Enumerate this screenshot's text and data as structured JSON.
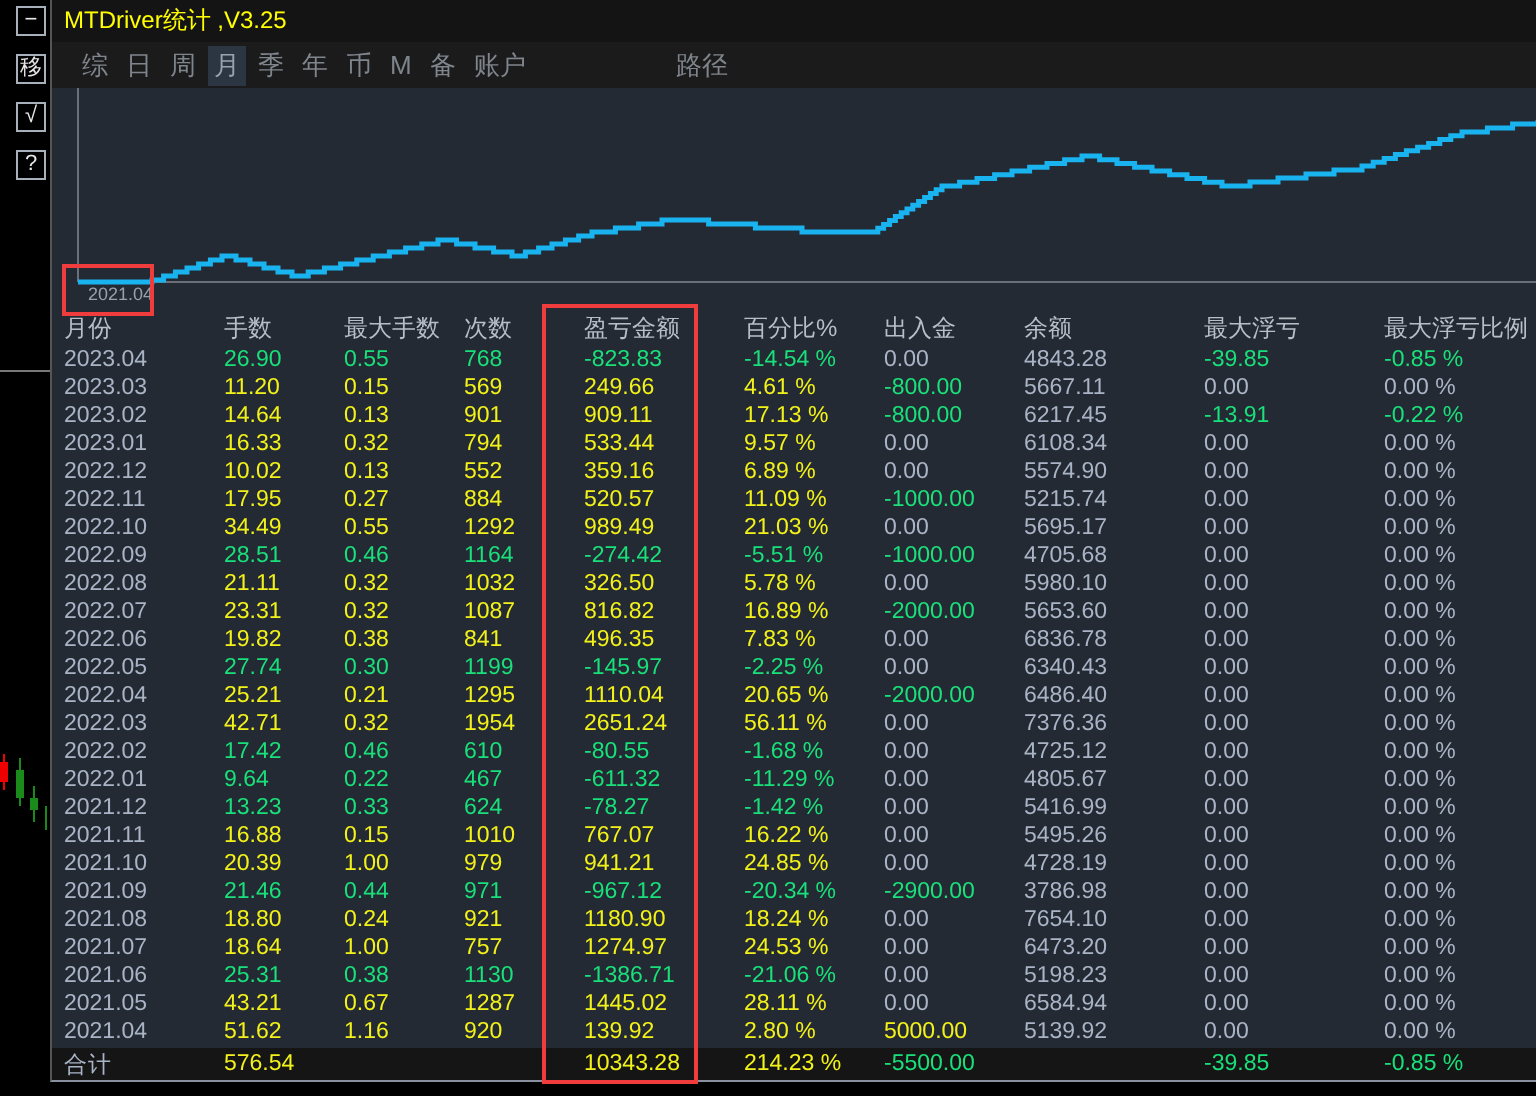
{
  "side_buttons": [
    "−",
    "移",
    "√",
    "?"
  ],
  "window": {
    "title": "MTDriver统计 ,V3.25"
  },
  "tabs": [
    {
      "label": "综",
      "selected": false
    },
    {
      "label": "日",
      "selected": false
    },
    {
      "label": "周",
      "selected": false
    },
    {
      "label": "月",
      "selected": true
    },
    {
      "label": "季",
      "selected": false
    },
    {
      "label": "年",
      "selected": false
    },
    {
      "label": "币",
      "selected": false
    },
    {
      "label": "M",
      "selected": false
    },
    {
      "label": "备",
      "selected": false
    },
    {
      "label": "账户",
      "selected": false
    },
    {
      "label": "路径",
      "selected": false
    }
  ],
  "chart": {
    "start_label": "2021.04"
  },
  "table": {
    "columns": [
      "月份",
      "手数",
      "最大手数",
      "次数",
      "盈亏金额",
      "百分比%",
      "出入金",
      "余额",
      "最大浮亏",
      "最大浮亏比例"
    ],
    "rows": [
      {
        "month": "2023.04",
        "lots": "26.90",
        "max_lots": "0.55",
        "trades": "768",
        "pnl": "-823.83",
        "pct": "-14.54 %",
        "deposit": {
          "text": "0.00",
          "kind": "none"
        },
        "balance": "4843.28",
        "max_dd": {
          "text": "-39.85",
          "kind": "loss"
        },
        "max_dd_pct": "-0.85 %",
        "kind": "loss"
      },
      {
        "month": "2023.03",
        "lots": "11.20",
        "max_lots": "0.15",
        "trades": "569",
        "pnl": "249.66",
        "pct": "4.61 %",
        "deposit": {
          "text": "-800.00",
          "kind": "out"
        },
        "balance": "5667.11",
        "max_dd": {
          "text": "0.00",
          "kind": "none"
        },
        "max_dd_pct": "0.00 %",
        "kind": "gain"
      },
      {
        "month": "2023.02",
        "lots": "14.64",
        "max_lots": "0.13",
        "trades": "901",
        "pnl": "909.11",
        "pct": "17.13 %",
        "deposit": {
          "text": "-800.00",
          "kind": "out"
        },
        "balance": "6217.45",
        "max_dd": {
          "text": "-13.91",
          "kind": "loss"
        },
        "max_dd_pct": "-0.22 %",
        "kind": "gain"
      },
      {
        "month": "2023.01",
        "lots": "16.33",
        "max_lots": "0.32",
        "trades": "794",
        "pnl": "533.44",
        "pct": "9.57 %",
        "deposit": {
          "text": "0.00",
          "kind": "none"
        },
        "balance": "6108.34",
        "max_dd": {
          "text": "0.00",
          "kind": "none"
        },
        "max_dd_pct": "0.00 %",
        "kind": "gain"
      },
      {
        "month": "2022.12",
        "lots": "10.02",
        "max_lots": "0.13",
        "trades": "552",
        "pnl": "359.16",
        "pct": "6.89 %",
        "deposit": {
          "text": "0.00",
          "kind": "none"
        },
        "balance": "5574.90",
        "max_dd": {
          "text": "0.00",
          "kind": "none"
        },
        "max_dd_pct": "0.00 %",
        "kind": "gain"
      },
      {
        "month": "2022.11",
        "lots": "17.95",
        "max_lots": "0.27",
        "trades": "884",
        "pnl": "520.57",
        "pct": "11.09 %",
        "deposit": {
          "text": "-1000.00",
          "kind": "out"
        },
        "balance": "5215.74",
        "max_dd": {
          "text": "0.00",
          "kind": "none"
        },
        "max_dd_pct": "0.00 %",
        "kind": "gain"
      },
      {
        "month": "2022.10",
        "lots": "34.49",
        "max_lots": "0.55",
        "trades": "1292",
        "pnl": "989.49",
        "pct": "21.03 %",
        "deposit": {
          "text": "0.00",
          "kind": "none"
        },
        "balance": "5695.17",
        "max_dd": {
          "text": "0.00",
          "kind": "none"
        },
        "max_dd_pct": "0.00 %",
        "kind": "gain"
      },
      {
        "month": "2022.09",
        "lots": "28.51",
        "max_lots": "0.46",
        "trades": "1164",
        "pnl": "-274.42",
        "pct": "-5.51 %",
        "deposit": {
          "text": "-1000.00",
          "kind": "out"
        },
        "balance": "4705.68",
        "max_dd": {
          "text": "0.00",
          "kind": "none"
        },
        "max_dd_pct": "0.00 %",
        "kind": "loss"
      },
      {
        "month": "2022.08",
        "lots": "21.11",
        "max_lots": "0.32",
        "trades": "1032",
        "pnl": "326.50",
        "pct": "5.78 %",
        "deposit": {
          "text": "0.00",
          "kind": "none"
        },
        "balance": "5980.10",
        "max_dd": {
          "text": "0.00",
          "kind": "none"
        },
        "max_dd_pct": "0.00 %",
        "kind": "gain"
      },
      {
        "month": "2022.07",
        "lots": "23.31",
        "max_lots": "0.32",
        "trades": "1087",
        "pnl": "816.82",
        "pct": "16.89 %",
        "deposit": {
          "text": "-2000.00",
          "kind": "out"
        },
        "balance": "5653.60",
        "max_dd": {
          "text": "0.00",
          "kind": "none"
        },
        "max_dd_pct": "0.00 %",
        "kind": "gain"
      },
      {
        "month": "2022.06",
        "lots": "19.82",
        "max_lots": "0.38",
        "trades": "841",
        "pnl": "496.35",
        "pct": "7.83 %",
        "deposit": {
          "text": "0.00",
          "kind": "none"
        },
        "balance": "6836.78",
        "max_dd": {
          "text": "0.00",
          "kind": "none"
        },
        "max_dd_pct": "0.00 %",
        "kind": "gain"
      },
      {
        "month": "2022.05",
        "lots": "27.74",
        "max_lots": "0.30",
        "trades": "1199",
        "pnl": "-145.97",
        "pct": "-2.25 %",
        "deposit": {
          "text": "0.00",
          "kind": "none"
        },
        "balance": "6340.43",
        "max_dd": {
          "text": "0.00",
          "kind": "none"
        },
        "max_dd_pct": "0.00 %",
        "kind": "loss"
      },
      {
        "month": "2022.04",
        "lots": "25.21",
        "max_lots": "0.21",
        "trades": "1295",
        "pnl": "1110.04",
        "pct": "20.65 %",
        "deposit": {
          "text": "-2000.00",
          "kind": "out"
        },
        "balance": "6486.40",
        "max_dd": {
          "text": "0.00",
          "kind": "none"
        },
        "max_dd_pct": "0.00 %",
        "kind": "gain"
      },
      {
        "month": "2022.03",
        "lots": "42.71",
        "max_lots": "0.32",
        "trades": "1954",
        "pnl": "2651.24",
        "pct": "56.11 %",
        "deposit": {
          "text": "0.00",
          "kind": "none"
        },
        "balance": "7376.36",
        "max_dd": {
          "text": "0.00",
          "kind": "none"
        },
        "max_dd_pct": "0.00 %",
        "kind": "gain"
      },
      {
        "month": "2022.02",
        "lots": "17.42",
        "max_lots": "0.46",
        "trades": "610",
        "pnl": "-80.55",
        "pct": "-1.68 %",
        "deposit": {
          "text": "0.00",
          "kind": "none"
        },
        "balance": "4725.12",
        "max_dd": {
          "text": "0.00",
          "kind": "none"
        },
        "max_dd_pct": "0.00 %",
        "kind": "loss"
      },
      {
        "month": "2022.01",
        "lots": "9.64",
        "max_lots": "0.22",
        "trades": "467",
        "pnl": "-611.32",
        "pct": "-11.29 %",
        "deposit": {
          "text": "0.00",
          "kind": "none"
        },
        "balance": "4805.67",
        "max_dd": {
          "text": "0.00",
          "kind": "none"
        },
        "max_dd_pct": "0.00 %",
        "kind": "loss"
      },
      {
        "month": "2021.12",
        "lots": "13.23",
        "max_lots": "0.33",
        "trades": "624",
        "pnl": "-78.27",
        "pct": "-1.42 %",
        "deposit": {
          "text": "0.00",
          "kind": "none"
        },
        "balance": "5416.99",
        "max_dd": {
          "text": "0.00",
          "kind": "none"
        },
        "max_dd_pct": "0.00 %",
        "kind": "loss"
      },
      {
        "month": "2021.11",
        "lots": "16.88",
        "max_lots": "0.15",
        "trades": "1010",
        "pnl": "767.07",
        "pct": "16.22 %",
        "deposit": {
          "text": "0.00",
          "kind": "none"
        },
        "balance": "5495.26",
        "max_dd": {
          "text": "0.00",
          "kind": "none"
        },
        "max_dd_pct": "0.00 %",
        "kind": "gain"
      },
      {
        "month": "2021.10",
        "lots": "20.39",
        "max_lots": "1.00",
        "trades": "979",
        "pnl": "941.21",
        "pct": "24.85 %",
        "deposit": {
          "text": "0.00",
          "kind": "none"
        },
        "balance": "4728.19",
        "max_dd": {
          "text": "0.00",
          "kind": "none"
        },
        "max_dd_pct": "0.00 %",
        "kind": "gain"
      },
      {
        "month": "2021.09",
        "lots": "21.46",
        "max_lots": "0.44",
        "trades": "971",
        "pnl": "-967.12",
        "pct": "-20.34 %",
        "deposit": {
          "text": "-2900.00",
          "kind": "out"
        },
        "balance": "3786.98",
        "max_dd": {
          "text": "0.00",
          "kind": "none"
        },
        "max_dd_pct": "0.00 %",
        "kind": "loss"
      },
      {
        "month": "2021.08",
        "lots": "18.80",
        "max_lots": "0.24",
        "trades": "921",
        "pnl": "1180.90",
        "pct": "18.24 %",
        "deposit": {
          "text": "0.00",
          "kind": "none"
        },
        "balance": "7654.10",
        "max_dd": {
          "text": "0.00",
          "kind": "none"
        },
        "max_dd_pct": "0.00 %",
        "kind": "gain"
      },
      {
        "month": "2021.07",
        "lots": "18.64",
        "max_lots": "1.00",
        "trades": "757",
        "pnl": "1274.97",
        "pct": "24.53 %",
        "deposit": {
          "text": "0.00",
          "kind": "none"
        },
        "balance": "6473.20",
        "max_dd": {
          "text": "0.00",
          "kind": "none"
        },
        "max_dd_pct": "0.00 %",
        "kind": "gain"
      },
      {
        "month": "2021.06",
        "lots": "25.31",
        "max_lots": "0.38",
        "trades": "1130",
        "pnl": "-1386.71",
        "pct": "-21.06 %",
        "deposit": {
          "text": "0.00",
          "kind": "none"
        },
        "balance": "5198.23",
        "max_dd": {
          "text": "0.00",
          "kind": "none"
        },
        "max_dd_pct": "0.00 %",
        "kind": "loss"
      },
      {
        "month": "2021.05",
        "lots": "43.21",
        "max_lots": "0.67",
        "trades": "1287",
        "pnl": "1445.02",
        "pct": "28.11 %",
        "deposit": {
          "text": "0.00",
          "kind": "none"
        },
        "balance": "6584.94",
        "max_dd": {
          "text": "0.00",
          "kind": "none"
        },
        "max_dd_pct": "0.00 %",
        "kind": "gain"
      },
      {
        "month": "2021.04",
        "lots": "51.62",
        "max_lots": "1.16",
        "trades": "920",
        "pnl": "139.92",
        "pct": "2.80 %",
        "deposit": {
          "text": "5000.00",
          "kind": "in"
        },
        "balance": "5139.92",
        "max_dd": {
          "text": "0.00",
          "kind": "none"
        },
        "max_dd_pct": "0.00 %",
        "kind": "gain"
      }
    ],
    "total": {
      "label": "合计",
      "lots": "576.54",
      "pnl": "10343.28",
      "pct": "214.23 %",
      "deposit": "-5500.00",
      "max_dd": "-39.85",
      "max_dd_pct": "-0.85 %"
    }
  }
}
